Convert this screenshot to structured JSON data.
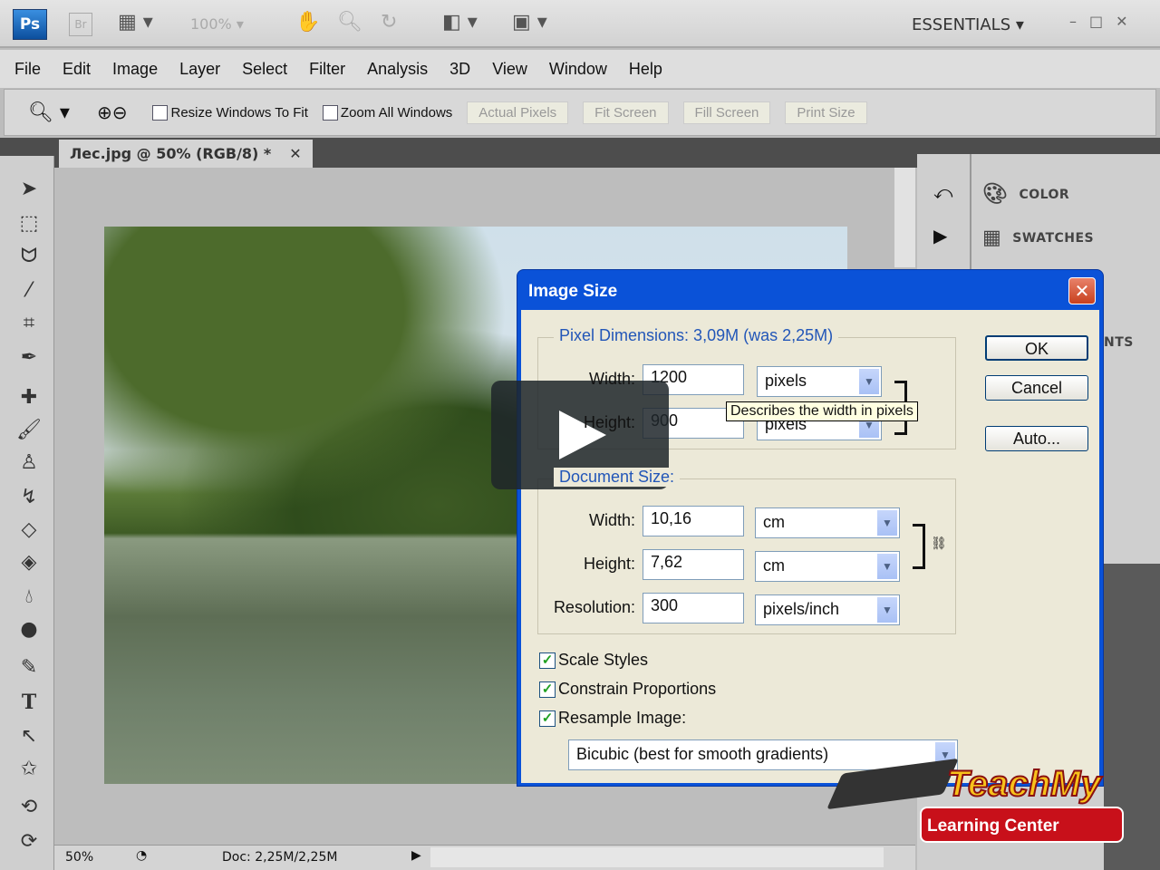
{
  "appbar": {
    "ps": "Ps",
    "br": "Br",
    "zoom": "100%",
    "workspace": "ESSENTIALS"
  },
  "menu": [
    "File",
    "Edit",
    "Image",
    "Layer",
    "Select",
    "Filter",
    "Analysis",
    "3D",
    "View",
    "Window",
    "Help"
  ],
  "options": {
    "resize_windows": "Resize Windows To Fit",
    "zoom_all": "Zoom All Windows",
    "buttons": [
      "Actual Pixels",
      "Fit Screen",
      "Fill Screen",
      "Print Size"
    ]
  },
  "document": {
    "tab": "Лес.jpg @ 50% (RGB/8) *",
    "zoom": "50%",
    "doc_info": "Doc: 2,25M/2,25M"
  },
  "panels": {
    "color": "COLOR",
    "swatches": "SWATCHES",
    "partial": "NTS"
  },
  "dialog": {
    "title": "Image Size",
    "pixel_dimensions": "Pixel Dimensions:  3,09M (was 2,25M)",
    "pixel": {
      "width_label": "Width:",
      "width": "1200",
      "width_unit": "pixels",
      "height_label": "Height:",
      "height": "900",
      "height_unit": "pixels"
    },
    "document_size": "Document Size:",
    "doc": {
      "width_label": "Width:",
      "width": "10,16",
      "width_unit": "cm",
      "height_label": "Height:",
      "height": "7,62",
      "height_unit": "cm",
      "res_label": "Resolution:",
      "resolution": "300",
      "res_unit": "pixels/inch"
    },
    "scale_styles": "Scale Styles",
    "constrain": "Constrain Proportions",
    "resample": "Resample Image:",
    "resample_method": "Bicubic (best for smooth gradients)",
    "ok": "OK",
    "cancel": "Cancel",
    "auto": "Auto...",
    "tooltip": "Describes the width in pixels"
  },
  "logo": {
    "line1": "TeachMy",
    "line2": "Learning Center"
  }
}
